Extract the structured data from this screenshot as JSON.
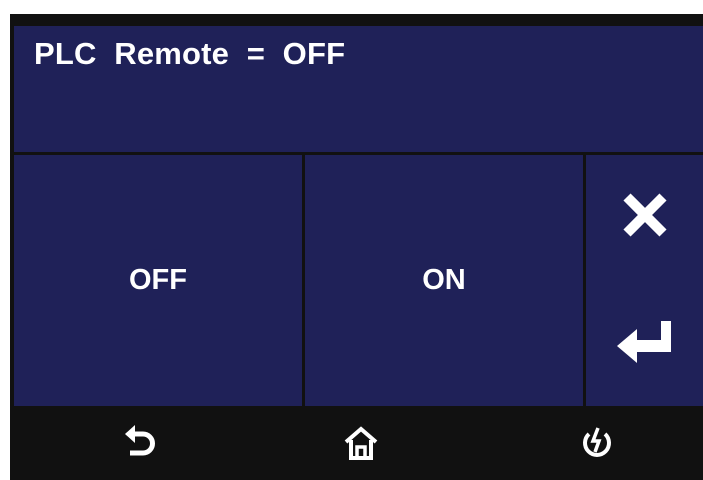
{
  "header": {
    "title": "PLC  Remote  =  OFF"
  },
  "options": {
    "off_label": "OFF",
    "on_label": "ON"
  },
  "side_actions": {
    "cancel_icon": "close-icon",
    "enter_icon": "enter-arrow-icon"
  },
  "footer": {
    "icons": [
      "back-arrow-icon",
      "home-icon",
      "power-icon"
    ]
  },
  "colors": {
    "panel": "#1f2158",
    "screen_background": "#111111",
    "border": "#ffffff",
    "text": "#ffffff"
  }
}
